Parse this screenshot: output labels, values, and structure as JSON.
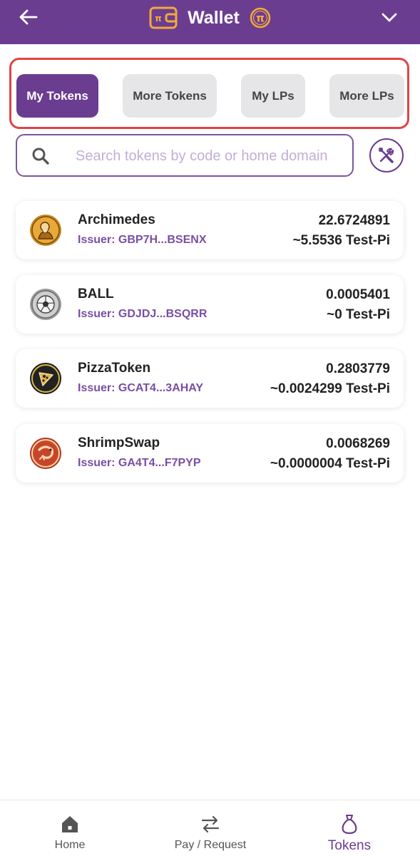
{
  "header": {
    "title": "Wallet",
    "back_icon": "arrow-left-icon",
    "wallet_icon": "wallet-icon",
    "pi_icon": "pi-coin-icon",
    "menu_icon": "chevron-down-icon",
    "bg_color": "#6b3d91",
    "accent_color": "#f2a93b"
  },
  "tabs": [
    {
      "label": "My Tokens",
      "active": true
    },
    {
      "label": "More Tokens",
      "active": false
    },
    {
      "label": "My LPs",
      "active": false
    },
    {
      "label": "More LPs",
      "active": false
    }
  ],
  "search": {
    "placeholder": "Search tokens by code or home domain",
    "value": "",
    "icon": "search-icon",
    "tools_icon": "tools-icon"
  },
  "tokens": [
    {
      "name": "Archimedes",
      "issuer": "Issuer: GBP7H...BSENX",
      "amount": "22.6724891",
      "value": "~5.5536 Test-Pi",
      "icon": "archimedes-token-icon"
    },
    {
      "name": "BALL",
      "issuer": "Issuer: GDJDJ...BSQRR",
      "amount": "0.0005401",
      "value": "~0 Test-Pi",
      "icon": "ball-token-icon"
    },
    {
      "name": "PizzaToken",
      "issuer": "Issuer: GCAT4...3AHAY",
      "amount": "0.2803779",
      "value": "~0.0024299 Test-Pi",
      "icon": "pizza-token-icon"
    },
    {
      "name": "ShrimpSwap",
      "issuer": "Issuer: GA4T4...F7PYP",
      "amount": "0.0068269",
      "value": "~0.0000004 Test-Pi",
      "icon": "shrimp-token-icon"
    }
  ],
  "bottom_nav": [
    {
      "label": "Home",
      "icon": "home-icon",
      "active": false
    },
    {
      "label": "Pay / Request",
      "icon": "transfer-icon",
      "active": false
    },
    {
      "label": "Tokens",
      "icon": "money-bag-icon",
      "active": true
    }
  ]
}
